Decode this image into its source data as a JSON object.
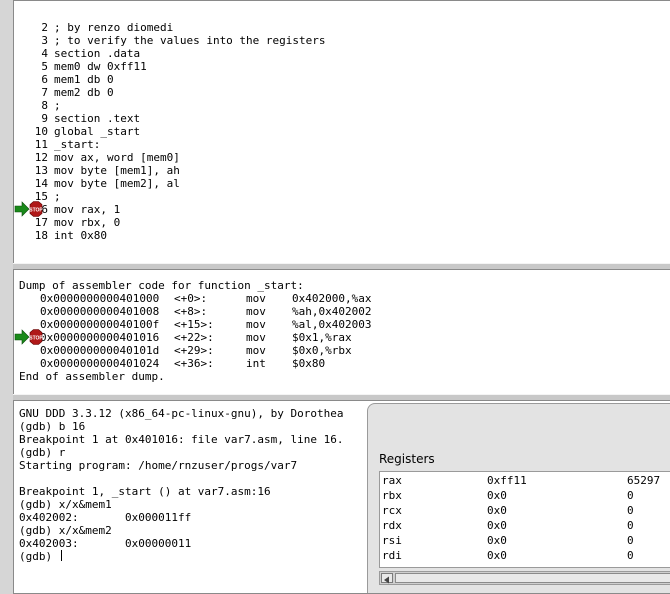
{
  "source": {
    "lines": [
      {
        "num": "2",
        "text": "; by renzo diomedi"
      },
      {
        "num": "3",
        "text": "; to verify the values into the registers"
      },
      {
        "num": "4",
        "text": "section .data"
      },
      {
        "num": "5",
        "text": "mem0 dw 0xff11"
      },
      {
        "num": "6",
        "text": "mem1 db 0"
      },
      {
        "num": "7",
        "text": "mem2 db 0"
      },
      {
        "num": "8",
        "text": ";"
      },
      {
        "num": "9",
        "text": "section .text"
      },
      {
        "num": "10",
        "text": "global _start"
      },
      {
        "num": "11",
        "text": "_start:"
      },
      {
        "num": "12",
        "text": "mov ax, word [mem0]"
      },
      {
        "num": "13",
        "text": "mov byte [mem1], ah"
      },
      {
        "num": "14",
        "text": "mov byte [mem2], al"
      },
      {
        "num": "15",
        "text": ";"
      },
      {
        "num": "16",
        "text": "mov rax, 1"
      },
      {
        "num": "17",
        "text": "mov rbx, 0"
      },
      {
        "num": "18",
        "text": "int 0x80"
      }
    ],
    "breakpoint_label": "STOP"
  },
  "machine": {
    "header": "Dump of assembler code for function _start:",
    "rows": [
      {
        "addr": "0x0000000000401000",
        "off": "<+0>:",
        "op": "mov",
        "args": "0x402000,%ax"
      },
      {
        "addr": "0x0000000000401008",
        "off": "<+8>:",
        "op": "mov",
        "args": "%ah,0x402002"
      },
      {
        "addr": "0x000000000040100f",
        "off": "<+15>:",
        "op": "mov",
        "args": "%al,0x402003"
      },
      {
        "addr": "0x0000000000401016",
        "off": "<+22>:",
        "op": "mov",
        "args": "$0x1,%rax"
      },
      {
        "addr": "0x000000000040101d",
        "off": "<+29>:",
        "op": "mov",
        "args": "$0x0,%rbx"
      },
      {
        "addr": "0x0000000000401024",
        "off": "<+36>:",
        "op": "int",
        "args": "$0x80"
      }
    ],
    "footer": "End of assembler dump.",
    "breakpoint_label": "STOP"
  },
  "console": {
    "lines": [
      "GNU DDD 3.3.12 (x86_64-pc-linux-gnu), by Dorothea",
      "(gdb) b 16",
      "Breakpoint 1 at 0x401016: file var7.asm, line 16.",
      "(gdb) r",
      "Starting program: /home/rnzuser/progs/var7",
      "",
      "Breakpoint 1, _start () at var7.asm:16",
      "(gdb) x/x&mem1",
      "0x402002:       0x000011ff",
      "(gdb) x/x&mem2",
      "0x402003:       0x00000011"
    ],
    "prompt": "(gdb) "
  },
  "registers": {
    "title": "Registers",
    "rows": [
      {
        "name": "rax",
        "hex": "0xff11",
        "dec": "65297"
      },
      {
        "name": "rbx",
        "hex": "0x0",
        "dec": "0"
      },
      {
        "name": "rcx",
        "hex": "0x0",
        "dec": "0"
      },
      {
        "name": "rdx",
        "hex": "0x0",
        "dec": "0"
      },
      {
        "name": "rsi",
        "hex": "0x0",
        "dec": "0"
      },
      {
        "name": "rdi",
        "hex": "0x0",
        "dec": "0"
      }
    ]
  },
  "colors": {
    "arrow": "#1a8a1a",
    "stop_sign": "#b01818",
    "stop_text": "#ffffff"
  },
  "icons": {
    "execution_arrow": "green-right-arrow",
    "breakpoint": "stop-sign",
    "scroll_left": "left-triangle"
  }
}
